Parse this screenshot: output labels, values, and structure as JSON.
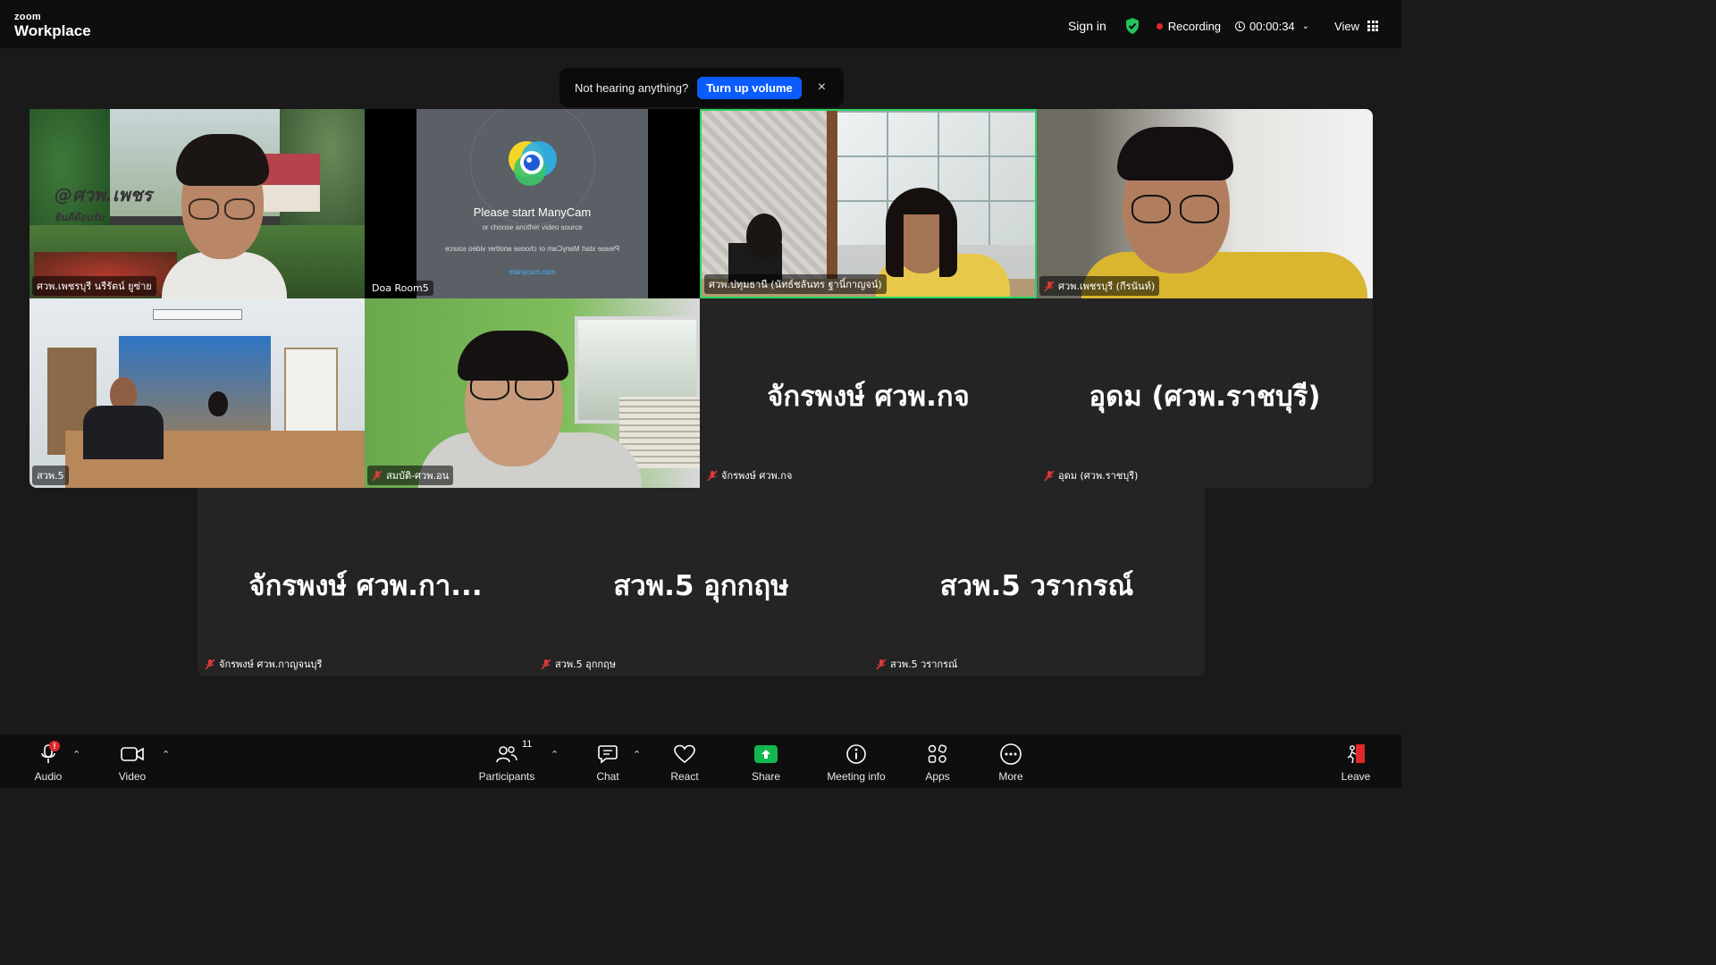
{
  "app": {
    "logo_small": "zoom",
    "logo_big": "Workplace"
  },
  "header": {
    "sign_in": "Sign in",
    "recording": "Recording",
    "timer": "00:00:34",
    "view": "View"
  },
  "banner": {
    "message": "Not hearing anything?",
    "button": "Turn up volume",
    "close": "×"
  },
  "tiles": {
    "t1": {
      "label": "ศวพ.เพชรบุรี นรีรัตน์  ยูซ่าย",
      "sign": "@ศวพ.เพชร",
      "sign2": "ยินดีต้อนรับ"
    },
    "t2": {
      "label": "Doa Room5",
      "manycam_title": "Please start ManyCam",
      "manycam_sub": "or choose another video source",
      "manycam_mirror": "Please start ManyCam or choose another video source",
      "manycam_link": "manycam.com"
    },
    "t3": {
      "label": "ศวพ.ปทุมธานี (นัทธ์ชลันทร  ฐานิ์กาญจน์)"
    },
    "t4": {
      "label": "ศวพ.เพชรบุรี (กีรนันท์)"
    },
    "t5": {
      "label": "สวพ.5"
    },
    "t6": {
      "label": "สมบัติ-ศวพ.อน"
    },
    "t7": {
      "name": "จักรพงษ์ ศวพ.กจ",
      "label": "จักรพงษ์ ศวพ.กจ"
    },
    "t8": {
      "name": "อุดม (ศวพ.ราชบุรี)",
      "label": "อุดม (ศวพ.ราชบุรี)"
    },
    "t9": {
      "name": "จักรพงษ์ ศวพ.กา...",
      "label": "จักรพงษ์ ศวพ.กาญจนบุรี"
    },
    "t10": {
      "name": "สวพ.5 อุกกฤษ",
      "label": "สวพ.5 อุกกฤษ"
    },
    "t11": {
      "name": "สวพ.5 วรากรณ์",
      "label": "สวพ.5 วรากรณ์"
    }
  },
  "toolbar": {
    "audio": "Audio",
    "audio_badge": "!",
    "video": "Video",
    "participants": "Participants",
    "participants_count": "11",
    "chat": "Chat",
    "react": "React",
    "share": "Share",
    "meeting_info": "Meeting info",
    "apps": "Apps",
    "more": "More",
    "leave": "Leave"
  },
  "colors": {
    "accent": "#0b5cff",
    "recording": "#e02828",
    "speaking": "#26d660",
    "share": "#12b84f"
  },
  "icons": [
    "shield-check-icon",
    "clock-icon",
    "grid-icon",
    "mic-muted-icon",
    "mic-icon",
    "camera-icon",
    "participants-icon",
    "chat-icon",
    "heart-icon",
    "share-arrow-icon",
    "info-icon",
    "apps-icon",
    "more-icon",
    "leave-icon"
  ]
}
